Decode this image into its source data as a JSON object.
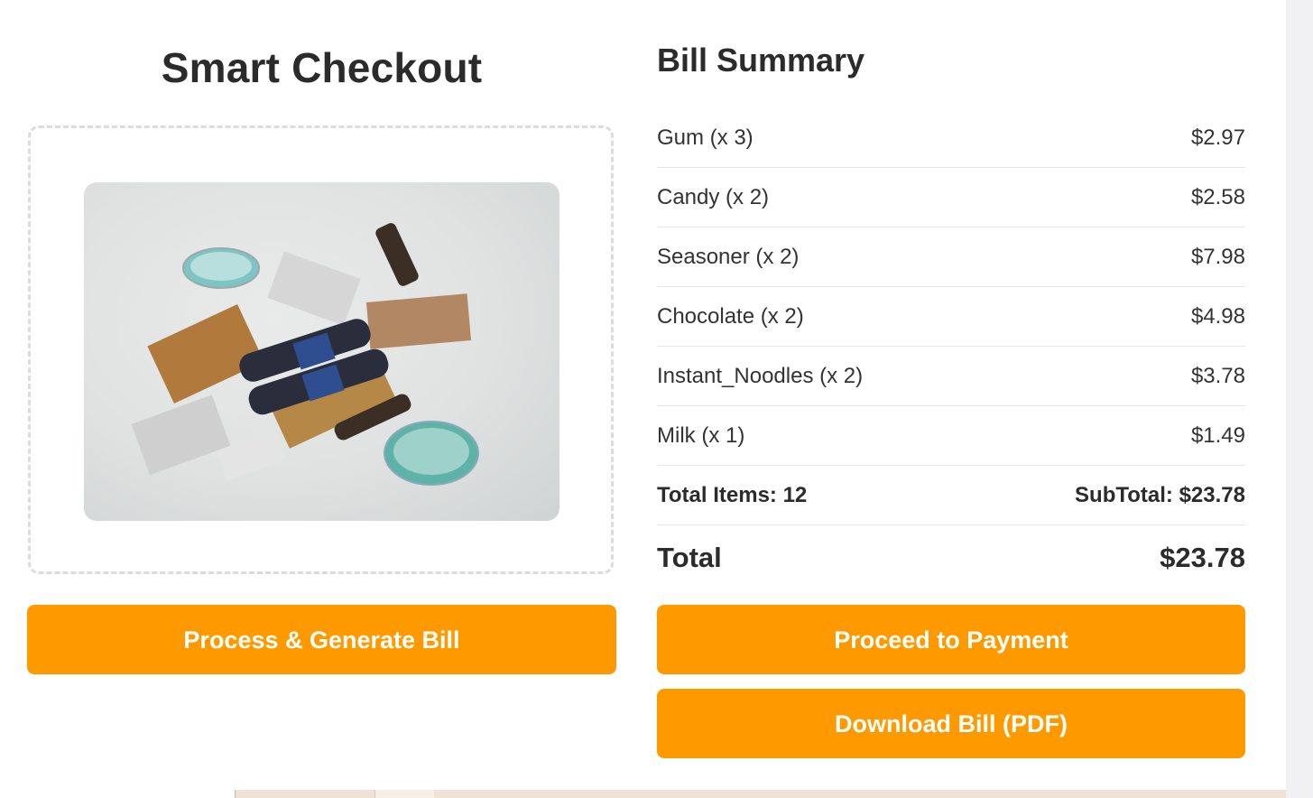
{
  "checkout": {
    "title": "Smart Checkout",
    "process_button": "Process & Generate Bill"
  },
  "bill": {
    "title": "Bill Summary",
    "items": [
      {
        "label": "Gum (x 3)",
        "price": "$2.97"
      },
      {
        "label": "Candy (x 2)",
        "price": "$2.58"
      },
      {
        "label": "Seasoner (x 2)",
        "price": "$7.98"
      },
      {
        "label": "Chocolate (x 2)",
        "price": "$4.98"
      },
      {
        "label": "Instant_Noodles (x 2)",
        "price": "$3.78"
      },
      {
        "label": "Milk (x 1)",
        "price": "$1.49"
      }
    ],
    "total_items": "Total Items: 12",
    "subtotal": "SubTotal: $23.78",
    "total_label": "Total",
    "total_value": "$23.78",
    "pay_button": "Proceed to Payment",
    "pdf_button": "Download Bill (PDF)"
  },
  "colors": {
    "accent": "#ff9900",
    "text": "#2b2b2b",
    "divider": "#e7e7e7"
  }
}
